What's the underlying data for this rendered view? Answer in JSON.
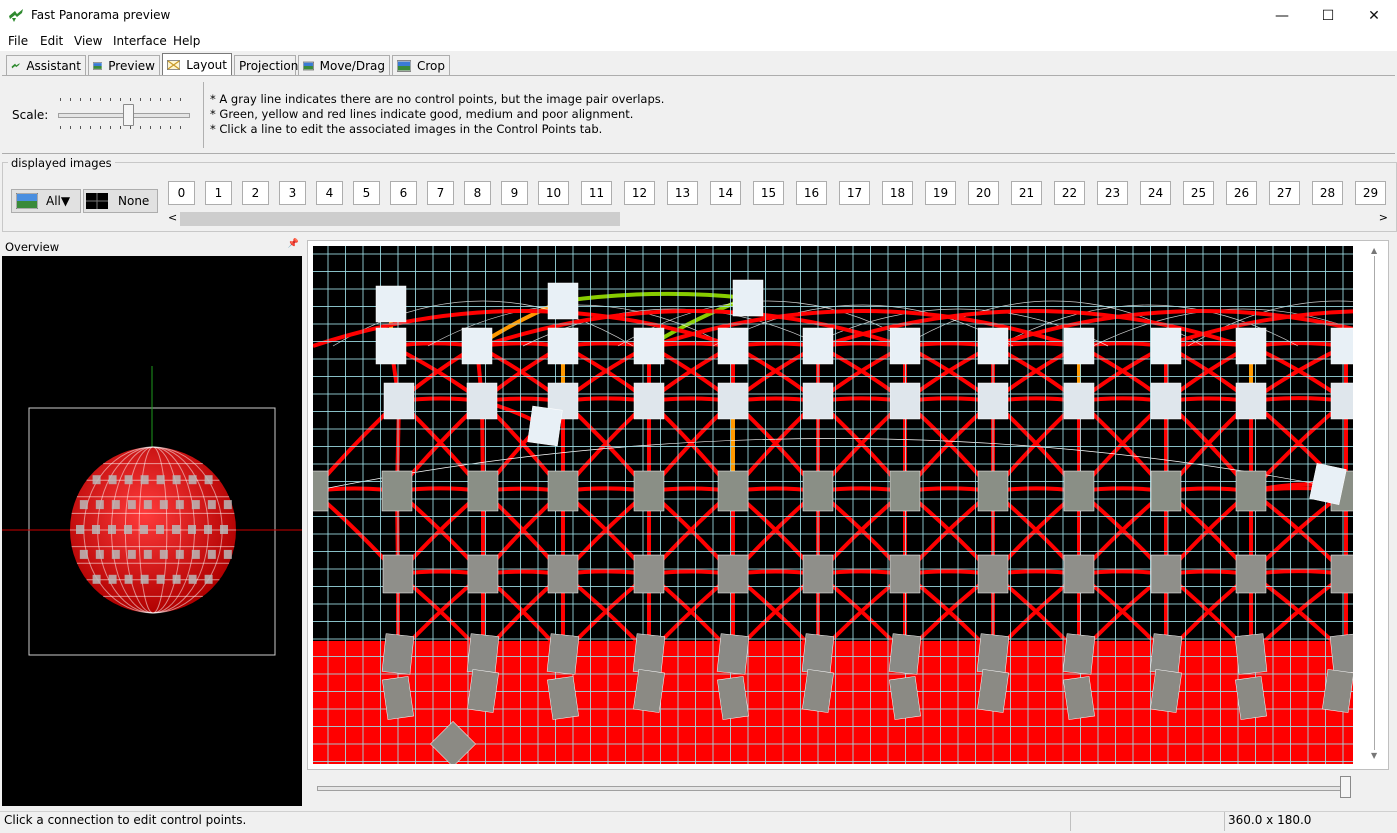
{
  "window": {
    "title": "Fast Panorama preview",
    "minimize": "—",
    "maximize": "☐",
    "close": "✕"
  },
  "menu": [
    "File",
    "Edit",
    "View",
    "Interface",
    "Help"
  ],
  "tabs": [
    "Assistant",
    "Preview",
    "Layout",
    "Projection",
    "Move/Drag",
    "Crop"
  ],
  "active_tab": "Layout",
  "scale_label": "Scale:",
  "hints": [
    "* A gray line indicates there are no control points, but the image pair overlaps.",
    "* Green, yellow and red lines indicate good, medium and poor alignment.",
    "* Click a line to edit the associated images in the Control Points tab."
  ],
  "displayed_images": {
    "label": "displayed images",
    "all_label": "All▼",
    "none_label": "None",
    "numbers": [
      "0",
      "1",
      "2",
      "3",
      "4",
      "5",
      "6",
      "7",
      "8",
      "9",
      "10",
      "11",
      "12",
      "13",
      "14",
      "15",
      "16",
      "17",
      "18",
      "19",
      "20",
      "21",
      "22",
      "23",
      "24",
      "25",
      "26",
      "27",
      "28",
      "29"
    ]
  },
  "overview": {
    "label": "Overview",
    "pin": "📌"
  },
  "scroll": {
    "left": "<",
    "right": ">",
    "up": "▲",
    "down": "▼"
  },
  "status": {
    "message": "Click a connection to edit control points.",
    "dims": "360.0 x 180.0"
  },
  "colors": {
    "link_poor": "#ff0000",
    "link_medium": "#ff9900",
    "link_good": "#88cc00",
    "grid": "#9fe0e8",
    "canvas_bg": "#000000"
  }
}
